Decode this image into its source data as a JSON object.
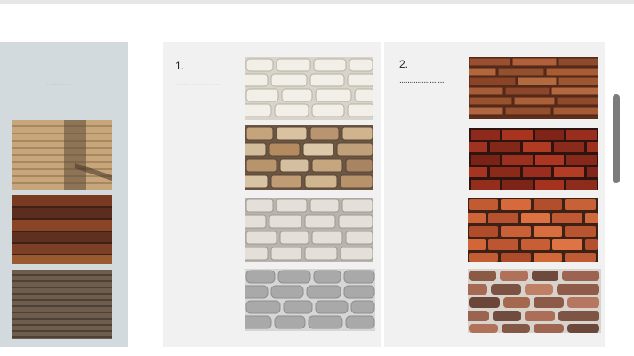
{
  "left_panel": {
    "blank": "............"
  },
  "panel_1": {
    "number": "1.",
    "blank": "......................"
  },
  "panel_2": {
    "number": "2.",
    "blank": "......................"
  },
  "swatches": {
    "left": [
      "beige-stone-texture",
      "red-brown-brick-strips",
      "dark-stone-strips"
    ],
    "panel_1": [
      "white-brick",
      "tan-brick",
      "light-grey-brick",
      "grey-stone-brick"
    ],
    "panel_2": [
      "red-brick-slim",
      "red-brick",
      "orange-brick",
      "multicolor-stone-brick"
    ]
  },
  "colors": {
    "left_panel_bg": "#d3dade",
    "card_bg": "#f1f1f2",
    "scrollbar": "#7c7c7c"
  }
}
